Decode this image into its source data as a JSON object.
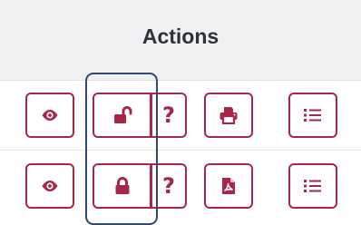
{
  "header": {
    "title": "Actions"
  },
  "rows": [
    {
      "view": "eye-icon",
      "lock": "lock-open-icon",
      "help": "?",
      "doc": "print-icon",
      "list": "list-icon"
    },
    {
      "view": "eye-icon",
      "lock": "lock-closed-icon",
      "help": "?",
      "doc": "pdf-icon",
      "list": "list-icon"
    }
  ],
  "colors": {
    "accent": "#a8264a",
    "focus": "#2f4a6e",
    "header_bg": "#f0f1f2"
  }
}
